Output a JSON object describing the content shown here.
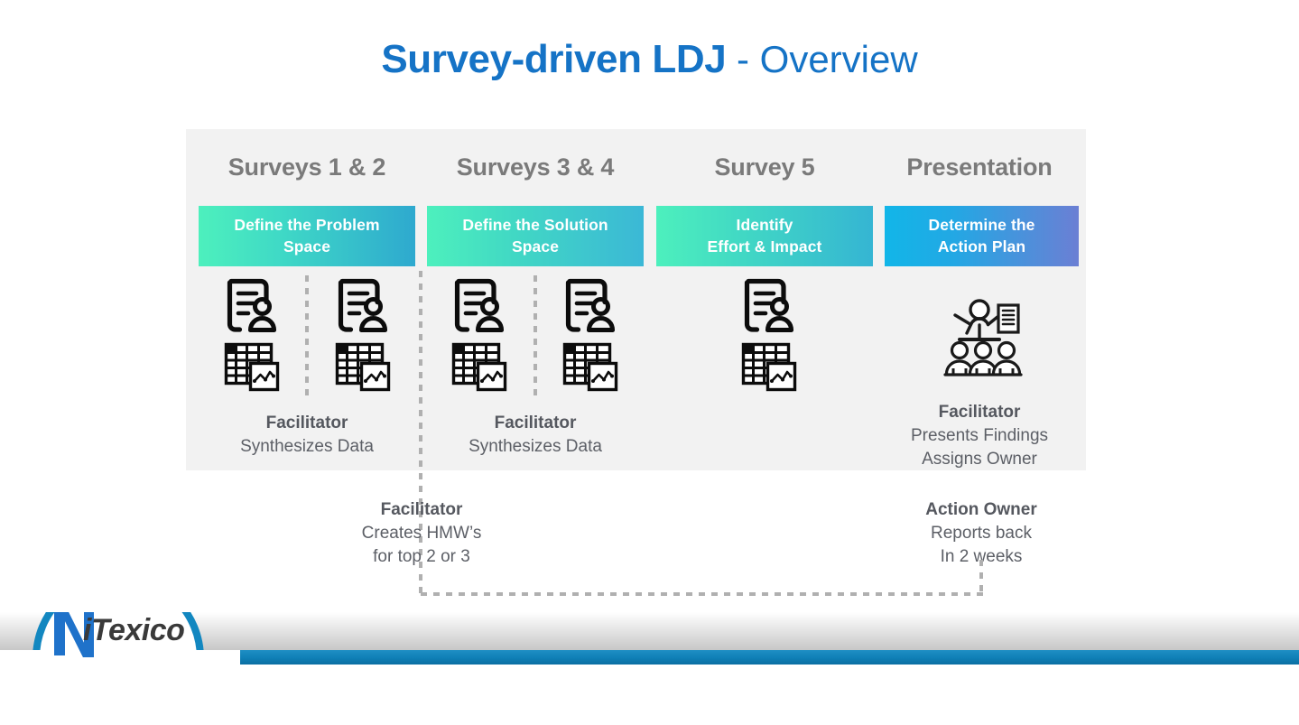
{
  "slide": {
    "title_bold": "Survey-driven LDJ",
    "title_light": " - Overview",
    "title_color": "#1573c6"
  },
  "columns": [
    {
      "header": "Surveys 1 & 2",
      "stage_label": "Define the Problem Space",
      "stage_gradient_from": "#4df0bd",
      "stage_gradient_to": "#2ea9cf",
      "icons": [
        "survey-document-person-icon",
        "spreadsheet-chart-icon"
      ],
      "icon_groups": 2,
      "caption": {
        "title": "Facilitator",
        "lines": [
          "Synthesizes Data"
        ]
      }
    },
    {
      "header": "Surveys 3 & 4",
      "stage_label": "Define the Solution Space",
      "stage_gradient_from": "#4df0bd",
      "stage_gradient_to": "#3bb8d6",
      "icons": [
        "survey-document-person-icon",
        "spreadsheet-chart-icon"
      ],
      "icon_groups": 2,
      "caption": {
        "title": "Facilitator",
        "lines": [
          "Synthesizes Data"
        ]
      }
    },
    {
      "header": "Survey 5",
      "stage_label": "Identify Effort & Impact",
      "stage_gradient_from": "#4df0bd",
      "stage_gradient_to": "#35b5d3",
      "icons": [
        "survey-document-person-icon",
        "spreadsheet-chart-icon"
      ],
      "icon_groups": 1,
      "caption": null
    },
    {
      "header": "Presentation",
      "stage_label": "Determine the Action Plan",
      "stage_gradient_from": "#12b6e8",
      "stage_gradient_to": "#6b7fd4",
      "icons": [
        "presentation-audience-icon"
      ],
      "icon_groups": 1,
      "caption": {
        "title": "Facilitator",
        "lines": [
          "Presents Findings",
          "Assigns Owner"
        ]
      }
    }
  ],
  "stage_labels": {
    "s1_line1": "Define the Problem",
    "s1_line2": "Space",
    "s2_line1": "Define the Solution",
    "s2_line2": "Space",
    "s3_line1": "Identify",
    "s3_line2": "Effort & Impact",
    "s4_line1": "Determine the",
    "s4_line2": "Action Plan"
  },
  "below_captions": [
    {
      "title": "Facilitator",
      "lines": [
        "Creates HMW’s",
        "for top 2 or 3"
      ]
    },
    {
      "title": "Action Owner",
      "lines": [
        "Reports back",
        "In 2 weeks"
      ]
    }
  ],
  "footer": {
    "logo_text": "iTexico",
    "band_color": "#0f7fb6"
  }
}
